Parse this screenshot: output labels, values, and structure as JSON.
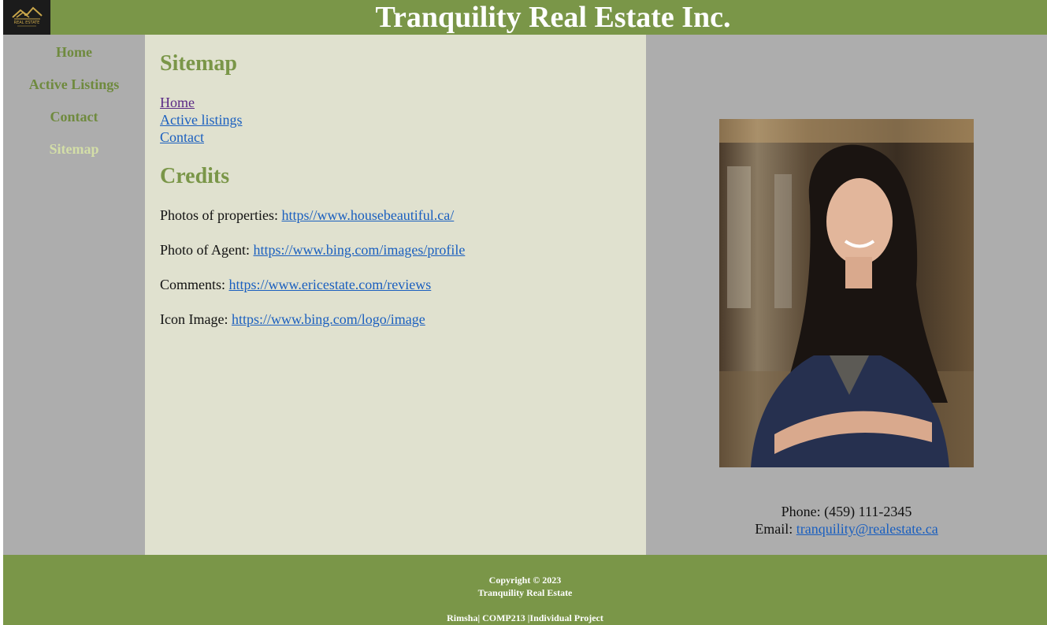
{
  "header": {
    "title": "Tranquility Real Estate Inc.",
    "logo_text": "REAL ESTATE"
  },
  "nav": {
    "items": [
      {
        "label": "Home",
        "active": false
      },
      {
        "label": "Active Listings",
        "active": false
      },
      {
        "label": "Contact",
        "active": false
      },
      {
        "label": "Sitemap",
        "active": true
      }
    ]
  },
  "main": {
    "sitemap_heading": "Sitemap",
    "sitemap_links": [
      "Home",
      "Active listings",
      "Contact"
    ],
    "credits_heading": "Credits",
    "credits": [
      {
        "label": "Photos of properties:",
        "link": "https//www.housebeautiful.ca/"
      },
      {
        "label": "Photo of Agent:",
        "link": "https://www.bing.com/images/profile"
      },
      {
        "label": "Comments:",
        "link": "https://www.ericestate.com/reviews"
      },
      {
        "label": "Icon Image:",
        "link": "https://www.bing.com/logo/image"
      }
    ]
  },
  "agent": {
    "phone_label": "Phone:",
    "phone": "(459) 111-2345",
    "email_label": "Email:",
    "email": "tranquility@realestate.ca"
  },
  "footer": {
    "copyright": "Copyright © 2023",
    "company": "Tranquility Real Estate",
    "project": "Rimsha| COMP213 |Individual Project"
  },
  "colors": {
    "brand_green": "#7a9648",
    "sidebar_gray": "#adadad",
    "content_beige": "#e0e1cf",
    "link_blue": "#1a5fbf",
    "active_nav": "#d3dea7"
  }
}
